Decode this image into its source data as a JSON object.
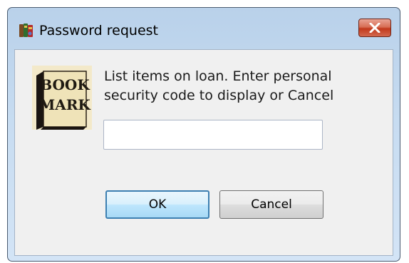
{
  "window": {
    "title": "Password request",
    "title_icon": "app-books-icon",
    "close_icon": "close-icon"
  },
  "logo": {
    "icon": "bookmark-logo-icon",
    "line1": "BOOK",
    "line2": "MARK"
  },
  "message": {
    "line1": "List items on loan. Enter personal",
    "line2": "security code to display or Cancel"
  },
  "input": {
    "value": "",
    "placeholder": ""
  },
  "buttons": {
    "ok": "OK",
    "cancel": "Cancel"
  },
  "colors": {
    "title_bar": "#c7dcf1",
    "client_bg": "#f0f0f0",
    "close_button": "#c2391c",
    "ok_border": "#3c7fb1"
  }
}
